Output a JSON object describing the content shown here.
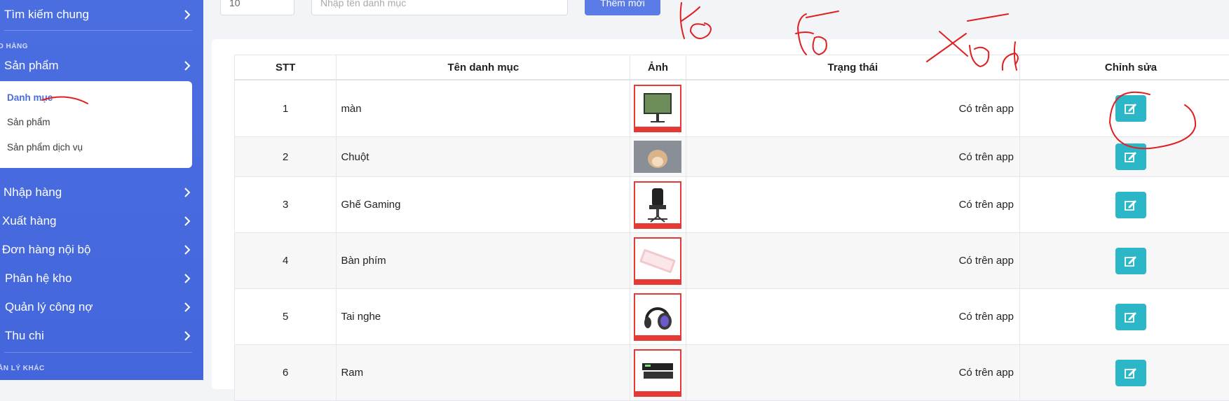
{
  "sidebar": {
    "top_item": "Tìm kiếm chung",
    "section_kho": "O HÀNG",
    "san_pham": "Sản phẩm",
    "submenu": [
      "Danh mục",
      "Sản phẩm",
      "Sản phẩm dịch vụ"
    ],
    "items": [
      "Nhập hàng",
      "Xuất hàng",
      "Đơn hàng nội bộ",
      "Phân hệ kho",
      "Quản lý công nợ",
      "Thu chi"
    ],
    "section_other": "ẢN LÝ KHÁC"
  },
  "topbar": {
    "page_size": "10",
    "search_placeholder": "Nhập tên danh mục",
    "add_label": "Thêm mới"
  },
  "table": {
    "headers": [
      "STT",
      "Tên danh mục",
      "Ảnh",
      "Trạng thái",
      "Chỉnh sửa"
    ],
    "rows": [
      {
        "stt": "1",
        "name": "màn",
        "status": "Có trên app",
        "image": "monitor"
      },
      {
        "stt": "2",
        "name": "Chuột",
        "status": "Có trên app",
        "image": "hamster"
      },
      {
        "stt": "3",
        "name": "Ghế Gaming",
        "status": "Có trên app",
        "image": "gaming-chair"
      },
      {
        "stt": "4",
        "name": "Bàn phím",
        "status": "Có trên app",
        "image": "keyboard"
      },
      {
        "stt": "5",
        "name": "Tai nghe",
        "status": "Có trên app",
        "image": "headphones"
      },
      {
        "stt": "6",
        "name": "Ram",
        "status": "Có trên app",
        "image": "ram"
      }
    ]
  },
  "icons": {
    "chevron": "chevron-right-icon",
    "edit": "edit-icon"
  },
  "colors": {
    "sidebar": "#4a6ee0",
    "edit_button": "#2bb7c8",
    "annotation": "#e02020"
  }
}
